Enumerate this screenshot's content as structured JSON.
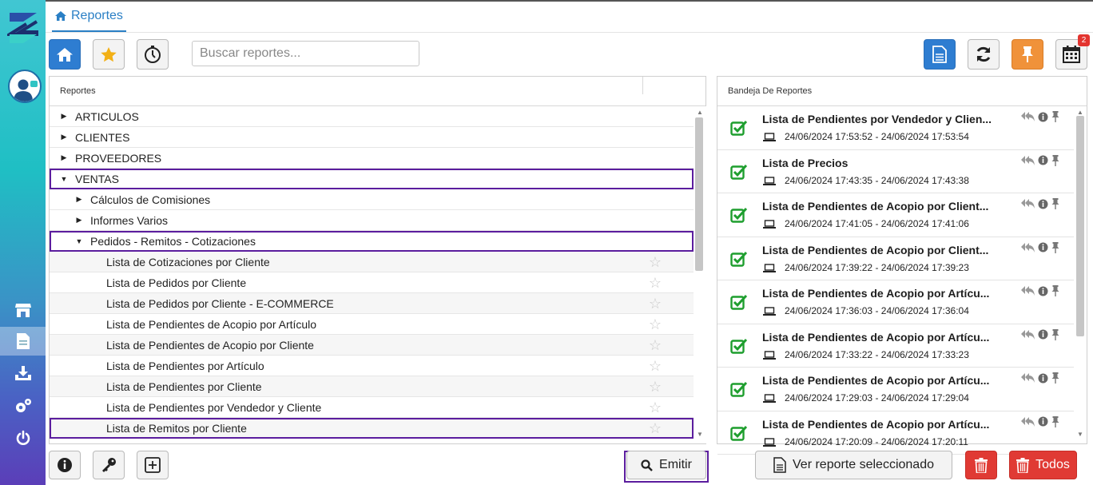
{
  "header": {
    "tab_label": "Reportes"
  },
  "search": {
    "placeholder": "Buscar reportes..."
  },
  "toolbar": {
    "calendar_badge": "2"
  },
  "left_panel": {
    "title": "Reportes",
    "rows": [
      {
        "label": "ARTICULOS"
      },
      {
        "label": "CLIENTES"
      },
      {
        "label": "PROVEEDORES"
      },
      {
        "label": "VENTAS"
      },
      {
        "label": "Cálculos de Comisiones"
      },
      {
        "label": "Informes Varios"
      },
      {
        "label": "Pedidos - Remitos - Cotizaciones"
      },
      {
        "label": "Lista de Cotizaciones por Cliente"
      },
      {
        "label": "Lista de Pedidos por Cliente"
      },
      {
        "label": "Lista de Pedidos por Cliente - E-COMMERCE"
      },
      {
        "label": "Lista de Pendientes de Acopio por Artículo"
      },
      {
        "label": "Lista de Pendientes de Acopio por Cliente"
      },
      {
        "label": "Lista de Pendientes por Artículo"
      },
      {
        "label": "Lista de Pendientes por Cliente"
      },
      {
        "label": "Lista de Pendientes por Vendedor y Cliente"
      },
      {
        "label": "Lista de Remitos por Cliente"
      }
    ]
  },
  "right_panel": {
    "title": "Bandeja De Reportes",
    "items": [
      {
        "title": "Lista de Pendientes por Vendedor y Clien...",
        "date": "24/06/2024 17:53:52 - 24/06/2024 17:53:54"
      },
      {
        "title": "Lista de Precios",
        "date": "24/06/2024 17:43:35 - 24/06/2024 17:43:38"
      },
      {
        "title": "Lista de Pendientes de Acopio por Client...",
        "date": "24/06/2024 17:41:05 - 24/06/2024 17:41:06"
      },
      {
        "title": "Lista de Pendientes de Acopio por Client...",
        "date": "24/06/2024 17:39:22 - 24/06/2024 17:39:23"
      },
      {
        "title": "Lista de Pendientes de Acopio por Artícu...",
        "date": "24/06/2024 17:36:03 - 24/06/2024 17:36:04"
      },
      {
        "title": "Lista de Pendientes de Acopio por Artícu...",
        "date": "24/06/2024 17:33:22 - 24/06/2024 17:33:23"
      },
      {
        "title": "Lista de Pendientes de Acopio por Artícu...",
        "date": "24/06/2024 17:29:03 - 24/06/2024 17:29:04"
      },
      {
        "title": "Lista de Pendientes de Acopio por Artícu...",
        "date": "24/06/2024 17:20:09 - 24/06/2024 17:20:11"
      }
    ]
  },
  "footer": {
    "emitir_label": "Emitir",
    "ver_reporte_label": "Ver reporte seleccionado",
    "todos_label": "Todos"
  },
  "colors": {
    "accent": "#2a7fc5",
    "highlight": "#5b1d9e",
    "danger": "#e03a34",
    "pin": "#f0923a",
    "check": "#1e9e2e"
  }
}
